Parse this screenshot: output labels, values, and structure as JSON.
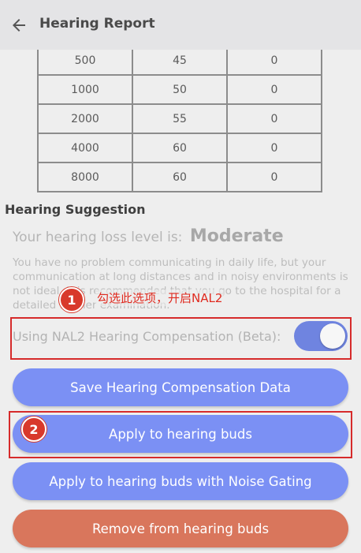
{
  "header": {
    "title": "Hearing Report",
    "back_icon": "arrow-left-icon"
  },
  "hearing_table": {
    "rows": [
      [
        "500",
        "45",
        "0"
      ],
      [
        "1000",
        "50",
        "0"
      ],
      [
        "2000",
        "55",
        "0"
      ],
      [
        "4000",
        "60",
        "0"
      ],
      [
        "8000",
        "60",
        "0"
      ]
    ]
  },
  "suggestion": {
    "title": "Hearing Suggestion",
    "level_prefix": "Your hearing loss level is:",
    "level_value": "Moderate",
    "description": "You have no problem communicating in daily life, but your communication at long distances and in noisy environments is not ideal. It is recommended that you go to the hospital for a detailed further examination."
  },
  "annotations": {
    "badge1": "1",
    "badge2": "2",
    "step1_text": "勾选此选项，开启NAL2",
    "accent_color": "#d62b2b"
  },
  "nal2": {
    "label": "Using NAL2 Hearing Compensation (Beta):",
    "enabled": true
  },
  "buttons": {
    "save": "Save Hearing Compensation Data",
    "apply": "Apply to hearing buds",
    "apply_noise": "Apply to hearing buds with Noise Gating",
    "remove": "Remove from hearing buds"
  },
  "colors": {
    "primary_button": "#7b90f4",
    "remove_button": "#d9765c",
    "toggle_on": "#6f84e0"
  }
}
